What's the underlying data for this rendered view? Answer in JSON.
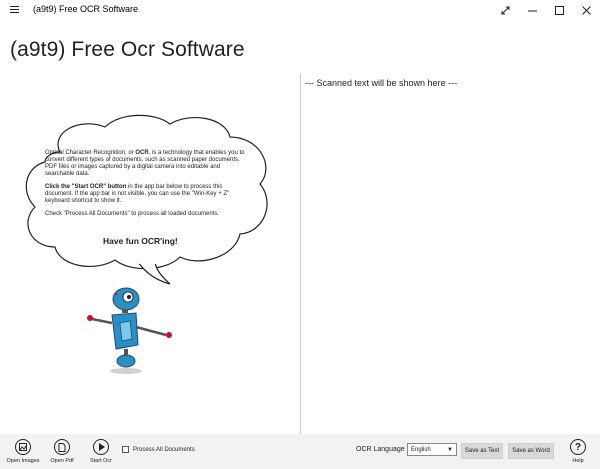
{
  "window": {
    "title": "(a9t9) Free OCR Software"
  },
  "page": {
    "heading": "(a9t9) Free Ocr Software",
    "scanned_placeholder": "--- Scanned text will be shown here ---"
  },
  "cloud": {
    "para1_pre": "Optical Character Recognition, or ",
    "para1_bold": "OCR",
    "para1_post": ", is a technology that enables you to convert different types of documents, such as scanned paper documents, PDF files or images captured by a digital camera into editable and searchable data.",
    "para2_bold": "Click the \"Start OCR\" button",
    "para2_post": " in the app bar below to process this document. If the app bar is not visible, you can use the \"Win-Key + Z\" keyboard shortcut to show it.",
    "para3": "Check \"Process All Documents\" to process all loaded documents.",
    "fun": "Have fun OCR'ing!"
  },
  "appbar": {
    "open_images": "Open Images",
    "open_pdf": "Open Pdf",
    "start_ocr": "Start Ocr",
    "process_all": "Process All Documents",
    "ocr_language_label": "OCR Language",
    "language_selected": "English",
    "save_text": "Save as Text",
    "save_word": "Save as Word",
    "help": "Help"
  },
  "icons": {
    "menu": "hamburger-icon",
    "expand": "expand-icon",
    "minimize": "minimize-icon",
    "maximize": "maximize-icon",
    "close": "close-icon",
    "open_images": "open-images-icon",
    "open_pdf": "open-pdf-icon",
    "start_ocr": "play-icon",
    "help": "help-icon"
  },
  "colors": {
    "appbar_bg": "#f2f2f2",
    "button_bg": "#d9d9d9",
    "robot_blue": "#2a8fc5",
    "robot_red": "#c8102e"
  }
}
